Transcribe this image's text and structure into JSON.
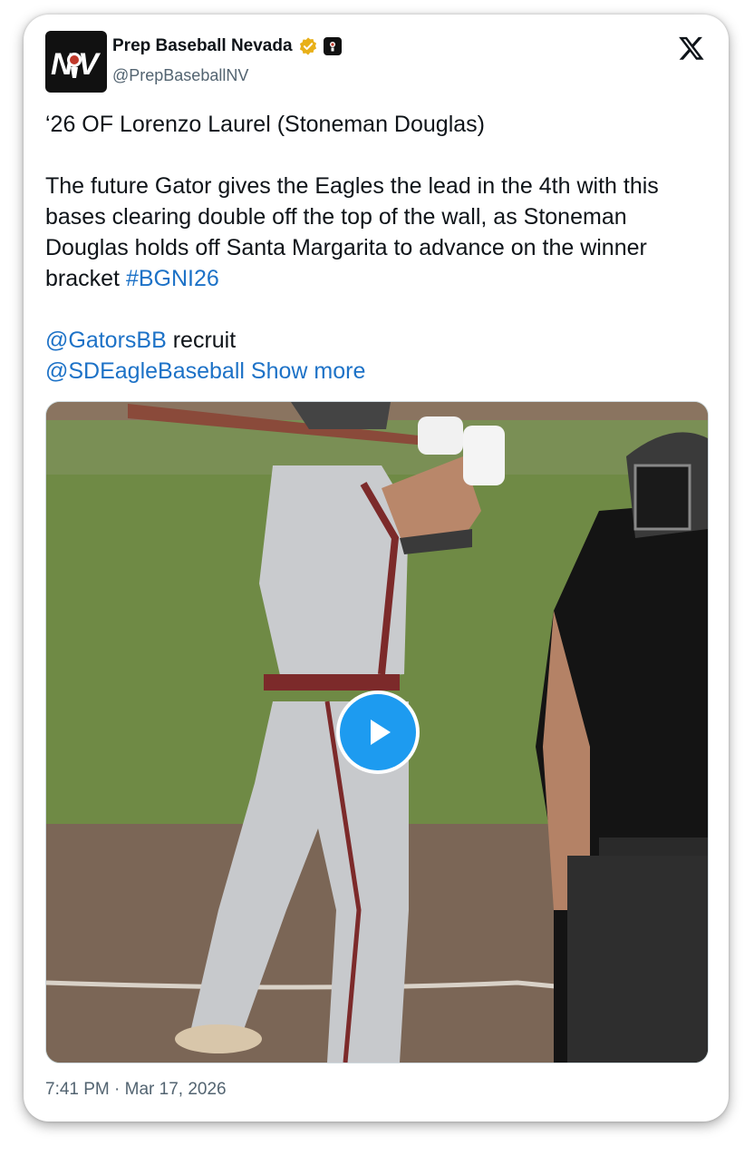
{
  "tweet": {
    "author_name": "Prep Baseball Nevada",
    "author_handle": "@PrepBaseballNV",
    "avatar_text": "NV",
    "headline": "‘26 OF Lorenzo Laurel (Stoneman Douglas)",
    "paragraph_before_tag": "The future Gator gives the Eagles the lead in the 4th with this bases clearing double off the top of the wall, as Stoneman Douglas holds off Santa Margarita to advance on the winner bracket ",
    "hashtag": "#BGNI26",
    "mention_1": "@GatorsBB",
    "mention_1_suffix": " recruit",
    "mention_2": "@SDEagleBaseball",
    "show_more": "Show more",
    "timestamp": "7:41 PM · Mar 17, 2026"
  },
  "icons": {
    "verified": "verified-badge-icon",
    "affiliation": "affiliate-badge-icon",
    "brand": "x-logo-icon",
    "play": "play-icon"
  },
  "colors": {
    "link": "#1d72c7",
    "play_button": "#1d9bf0",
    "verified_gold": "#e8b019",
    "text": "#0f1419",
    "muted": "#536471"
  }
}
